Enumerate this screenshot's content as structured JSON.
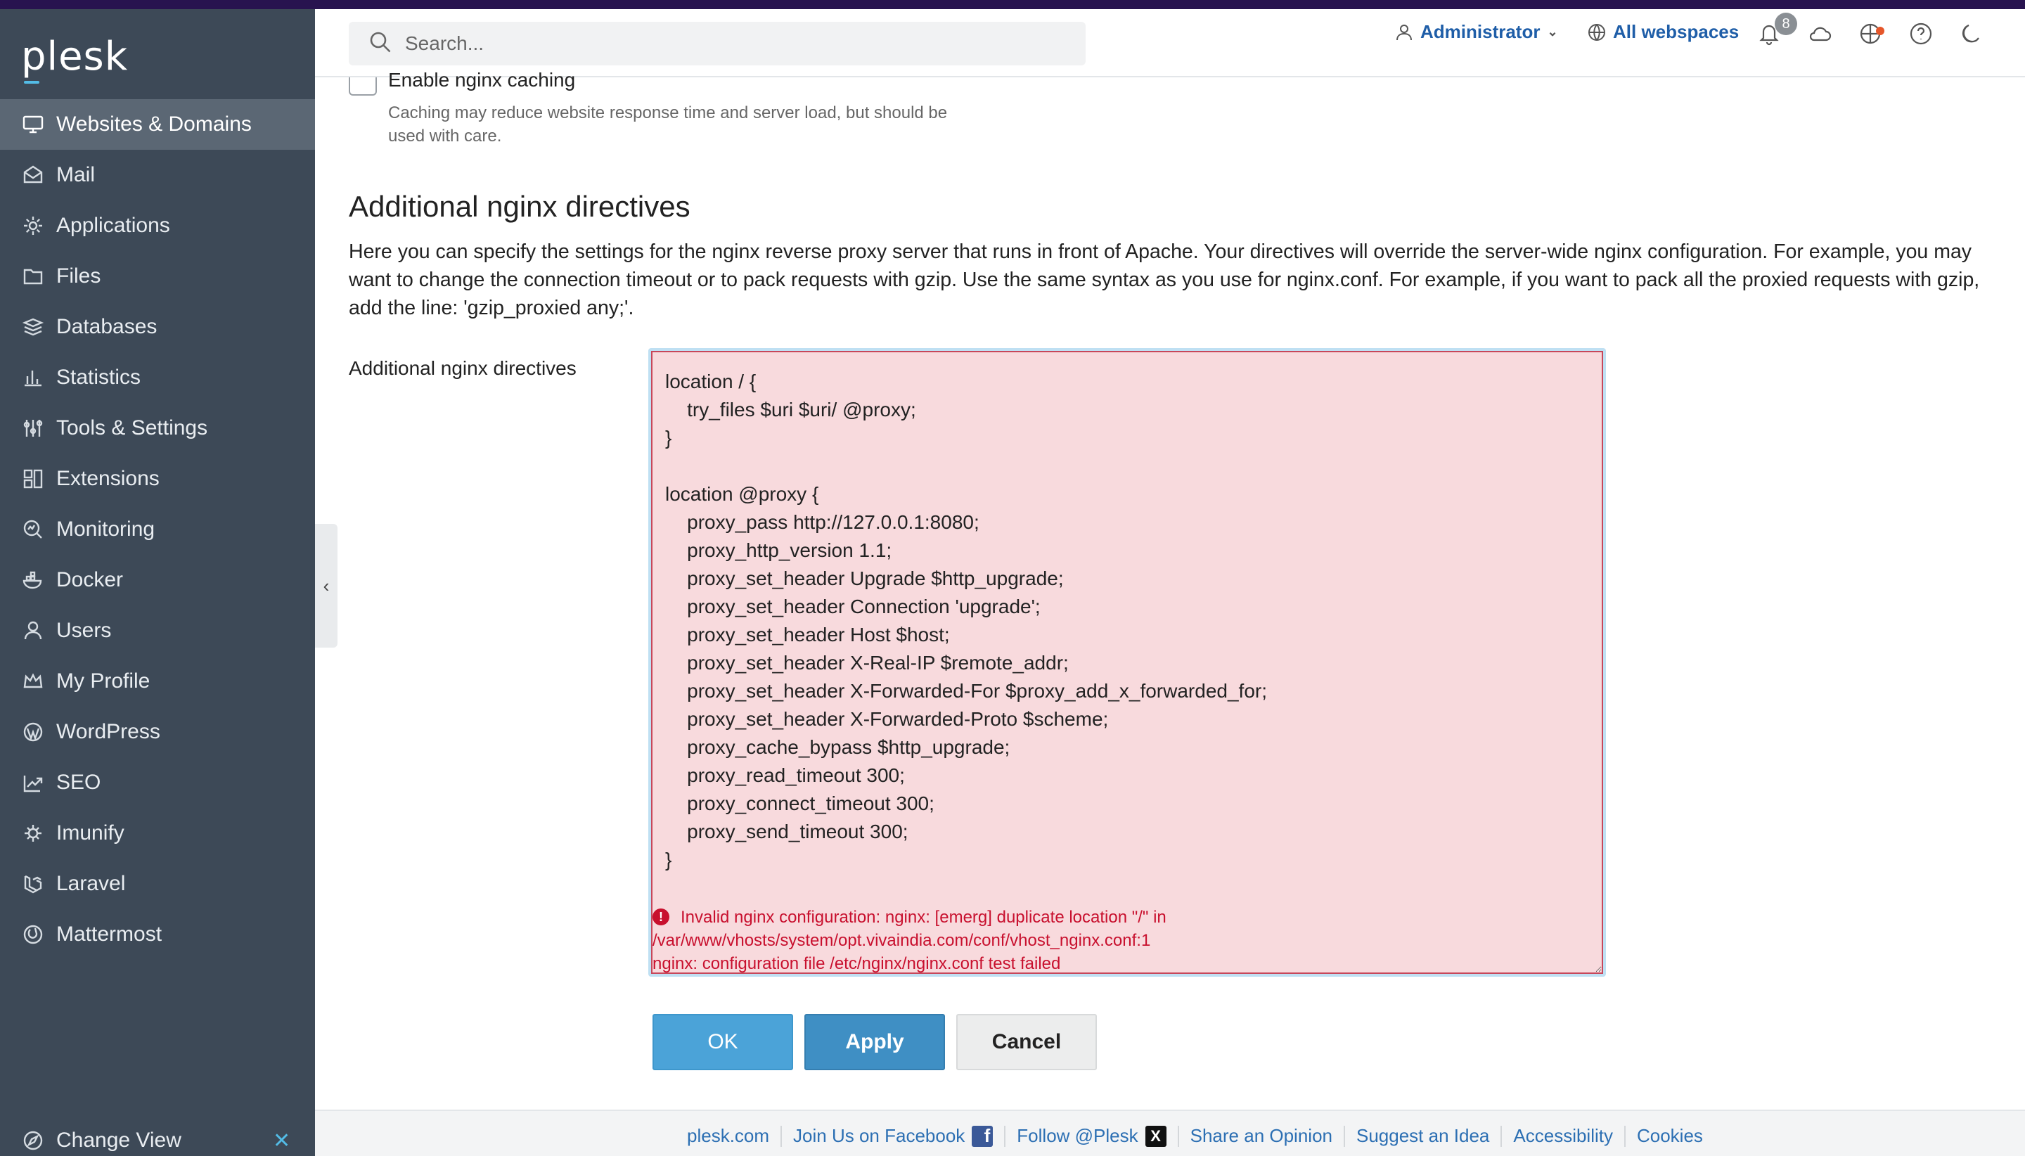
{
  "brand": {
    "logo": "plesk"
  },
  "search": {
    "placeholder": "Search..."
  },
  "header": {
    "user": "Administrator",
    "webspaces": "All webspaces",
    "notification_count": "8"
  },
  "sidebar": {
    "items": [
      {
        "label": "Websites & Domains",
        "icon": "monitor-icon",
        "active": true
      },
      {
        "label": "Mail",
        "icon": "mail-icon"
      },
      {
        "label": "Applications",
        "icon": "gear-icon"
      },
      {
        "label": "Files",
        "icon": "folder-icon"
      },
      {
        "label": "Databases",
        "icon": "database-icon"
      },
      {
        "label": "Statistics",
        "icon": "bar-chart-icon"
      },
      {
        "label": "Tools & Settings",
        "icon": "sliders-icon"
      },
      {
        "label": "Extensions",
        "icon": "extensions-icon"
      },
      {
        "label": "Monitoring",
        "icon": "monitoring-icon"
      },
      {
        "label": "Docker",
        "icon": "docker-icon"
      },
      {
        "label": "Users",
        "icon": "user-icon"
      },
      {
        "label": "My Profile",
        "icon": "crown-icon"
      },
      {
        "label": "WordPress",
        "icon": "wordpress-icon"
      },
      {
        "label": "SEO",
        "icon": "seo-icon"
      },
      {
        "label": "Imunify",
        "icon": "imunify-icon"
      },
      {
        "label": "Laravel",
        "icon": "laravel-icon"
      },
      {
        "label": "Mattermost",
        "icon": "mattermost-icon"
      }
    ],
    "change_view": "Change View"
  },
  "caching": {
    "label": "Enable nginx caching",
    "checked": false,
    "description": "Caching may reduce website response time and server load, but should be used with care."
  },
  "section": {
    "title": "Additional nginx directives",
    "description": "Here you can specify the settings for the nginx reverse proxy server that runs in front of Apache. Your directives will override the server-wide nginx configuration. For example, you may want to change the connection timeout or to pack requests with gzip. Use the same syntax as you use for nginx.conf. For example, if you want to pack all the proxied requests with gzip, add the line: 'gzip_proxied any;'.",
    "field_label": "Additional nginx directives",
    "directives": "location / {\n    try_files $uri $uri/ @proxy;\n}\n\nlocation @proxy {\n    proxy_pass http://127.0.0.1:8080;\n    proxy_http_version 1.1;\n    proxy_set_header Upgrade $http_upgrade;\n    proxy_set_header Connection 'upgrade';\n    proxy_set_header Host $host;\n    proxy_set_header X-Real-IP $remote_addr;\n    proxy_set_header X-Forwarded-For $proxy_add_x_forwarded_for;\n    proxy_set_header X-Forwarded-Proto $scheme;\n    proxy_cache_bypass $http_upgrade;\n    proxy_read_timeout 300;\n    proxy_connect_timeout 300;\n    proxy_send_timeout 300;\n}",
    "error_line1": "Invalid nginx configuration: nginx: [emerg] duplicate location \"/\" in",
    "error_line2": "/var/www/vhosts/system/opt.vivaindia.com/conf/vhost_nginx.conf:1",
    "error_line3": "nginx: configuration file /etc/nginx/nginx.conf test failed"
  },
  "buttons": {
    "ok": "OK",
    "apply": "Apply",
    "cancel": "Cancel"
  },
  "footer": {
    "links": [
      "plesk.com",
      "Join Us on Facebook",
      "Follow @Plesk",
      "Share an Opinion",
      "Suggest an Idea",
      "Accessibility",
      "Cookies"
    ]
  },
  "colors": {
    "sidebar_bg": "#3d4957",
    "active_item": "#5b6774",
    "error": "#c8102e",
    "textarea_error_bg": "#f8dadd",
    "primary_button": "#4ba3d8"
  }
}
